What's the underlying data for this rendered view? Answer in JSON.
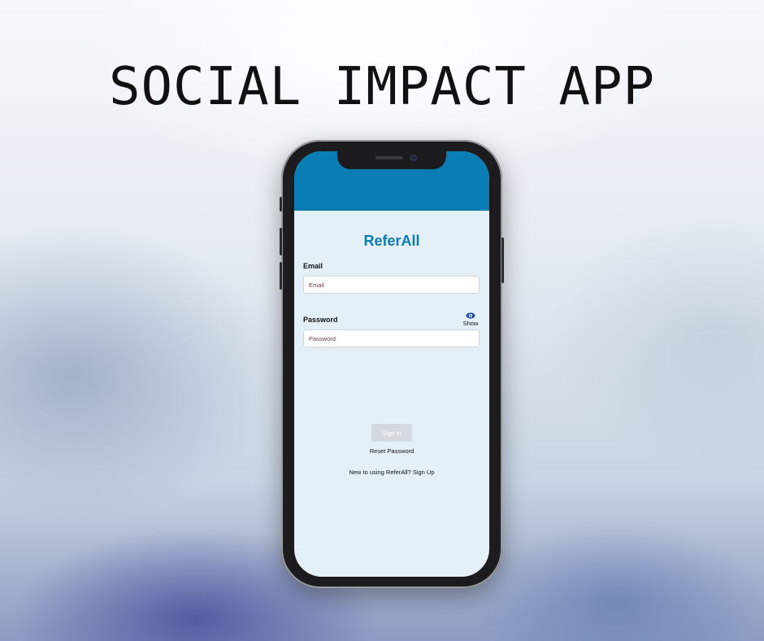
{
  "headline": "SOCIAL IMPACT APP",
  "app": {
    "brand": "ReferAll",
    "email": {
      "label": "Email",
      "placeholder": "Email",
      "value": ""
    },
    "password": {
      "label": "Password",
      "placeholder": "Password",
      "value": "",
      "toggle_label": "Show",
      "toggle_icon": "eye-icon"
    },
    "sign_in_label": "Sign In",
    "reset_label": "Reset Password",
    "signup_label": "New to using ReferAll? Sign Up"
  },
  "colors": {
    "header_blue": "#0a7db5",
    "screen_bg": "#e5eff7",
    "button_disabled": "#d3d9df",
    "eye_icon": "#1f4fa8"
  }
}
